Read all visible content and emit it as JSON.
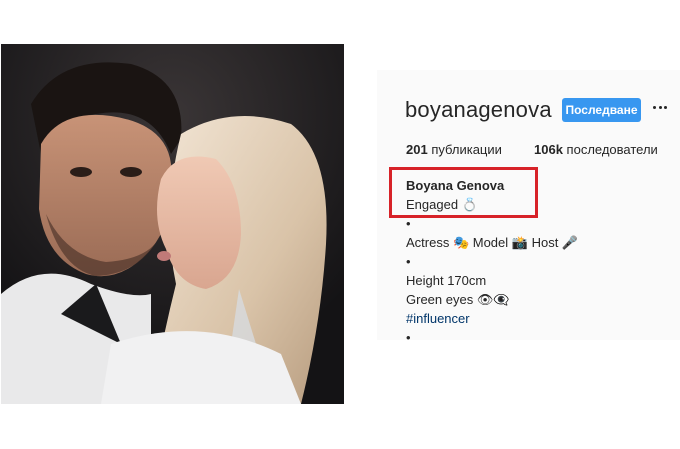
{
  "profile": {
    "username": "boyanagenova",
    "follow_label": "Последване",
    "more_icon": "ellipsis-icon",
    "stats": {
      "posts_count": "201",
      "posts_label": "публикации",
      "followers_count": "106k",
      "followers_label": "последователи"
    },
    "bio": {
      "name": "Boyana Genova",
      "status": "Engaged 💍",
      "bullet": "•",
      "roles": "Actress 🎭 Model 📸 Host 🎤",
      "height": "Height 170cm",
      "eyes": "Green eyes 👁👁‍🗨",
      "hashtag": "#influencer"
    }
  },
  "colors": {
    "follow_button": "#3897f0",
    "highlight_box": "#d72228",
    "hashtag": "#003569",
    "panel_background": "#fafafa"
  }
}
